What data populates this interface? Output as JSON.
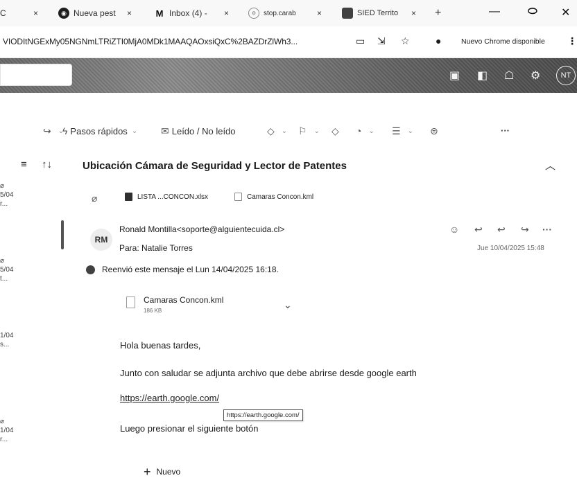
{
  "browser": {
    "tabs": [
      {
        "label": "C",
        "icon": "google-icon"
      },
      {
        "label": "Nueva pest",
        "icon": "chrome-icon"
      },
      {
        "label": "Inbox (4) -",
        "icon": "gmail-icon"
      },
      {
        "label": "stop.carab",
        "icon": "site-icon"
      },
      {
        "label": "SIED Territo",
        "icon": "sied-icon"
      }
    ],
    "new_tab_glyph": "+",
    "url": "VIODItNGExMy05NGNmLTRiZTI0MjA0MDk1MAAQAOxsiQxC%2BAZDrZlWh3...",
    "update_label": "Nuevo Chrome disponible"
  },
  "toolbar": {
    "pasos_rapidos": "Pasos rápidos",
    "leido": "Leído / No leído",
    "more": "···"
  },
  "list": {
    "sort_glyph": "↑↓",
    "items": [
      {
        "date": "5/04",
        "sub": "r..."
      },
      {
        "date": "5/04",
        "sub": "t..."
      },
      {
        "date": "1/04",
        "sub": "s..."
      },
      {
        "date": "1/04",
        "sub": "r..."
      }
    ]
  },
  "message": {
    "subject": "Ubicación Cámara de Seguridad y Lector de Patentes",
    "attachments": [
      "LISTA ...CONCON.xlsx",
      "Camaras Concon.kml"
    ],
    "avatar_initials": "RM",
    "from": "Ronald Montilla<soporte@alguientecuida.cl>",
    "to": "Para:  Natalie Torres",
    "date": "Jue 10/04/2025 15:48",
    "forwarded": "Reenvió este mensaje el Lun 14/04/2025 16:18.",
    "card": {
      "name": "Camaras Concon.kml",
      "size": "186 KB"
    },
    "body": {
      "greeting": "Hola buenas tardes,",
      "line1": "Junto con saludar se adjunta archivo que debe abrirse desde google earth",
      "link": "https://earth.google.com/",
      "line2": "Luego presionar el siguiente botón",
      "tooltip": "https://earth.google.com/"
    },
    "nuevo": "Nuevo"
  },
  "user": {
    "initials": "NT"
  }
}
